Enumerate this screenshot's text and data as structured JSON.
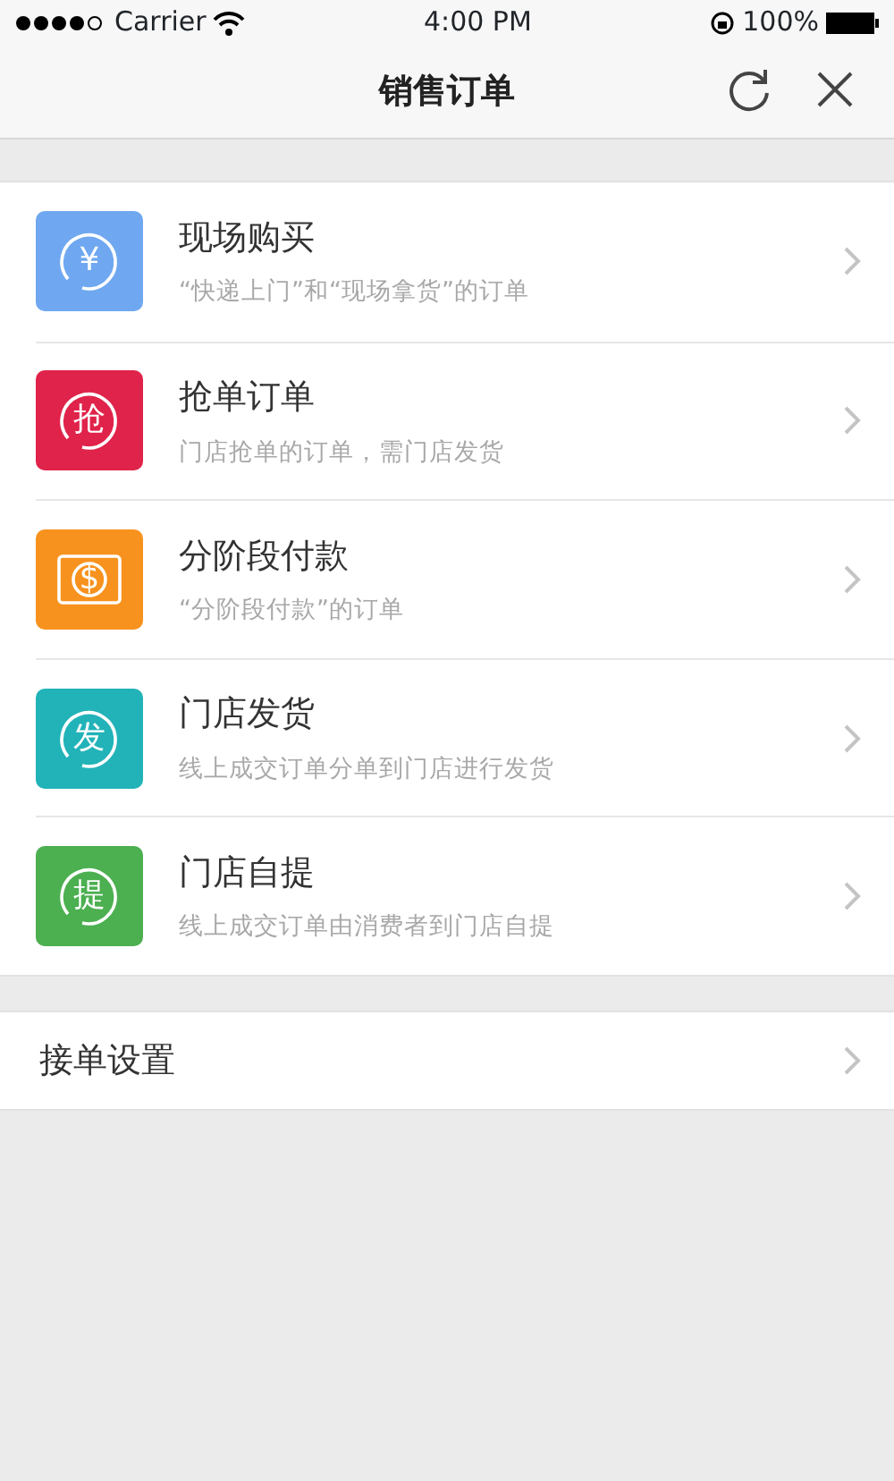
{
  "status_bar": {
    "carrier": "Carrier",
    "time": "4:00 PM",
    "battery": "100%"
  },
  "nav": {
    "title": "销售订单"
  },
  "order_types": [
    {
      "title": "现场购买",
      "subtitle": "“快递上门”和“现场拿货”的订单",
      "kind": "circle",
      "glyph": "¥",
      "color": "#6fa8f0"
    },
    {
      "title": "抢单订单",
      "subtitle": "门店抢单的订单，需门店发货",
      "kind": "circle",
      "glyph": "抢",
      "color": "#e0234a"
    },
    {
      "title": "分阶段付款",
      "subtitle": "“分阶段付款”的订单",
      "kind": "bill",
      "glyph": "$",
      "color": "#f7921e"
    },
    {
      "title": "门店发货",
      "subtitle": "线上成交订单分单到门店进行发货",
      "kind": "circle",
      "glyph": "发",
      "color": "#21b3b8"
    },
    {
      "title": "门店自提",
      "subtitle": "线上成交订单由消费者到门店自提",
      "kind": "circle",
      "glyph": "提",
      "color": "#4caf50"
    }
  ],
  "settings": [
    {
      "label": "接单设置"
    }
  ]
}
